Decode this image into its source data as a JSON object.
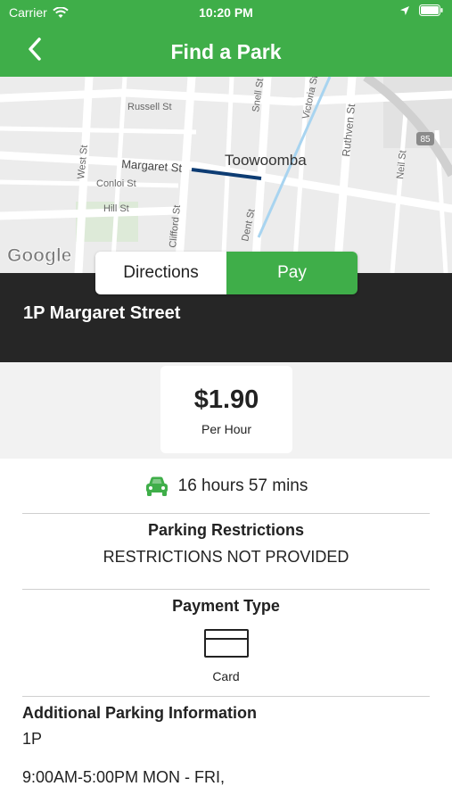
{
  "status_bar": {
    "carrier": "Carrier",
    "time": "10:20 PM"
  },
  "nav": {
    "title": "Find a Park"
  },
  "map": {
    "streets": {
      "russell": "Russell St",
      "margaret": "Margaret St",
      "conloi": "Conloi St",
      "hill": "Hill St",
      "west": "West St",
      "clifford": "Clifford St",
      "dent": "Dent St",
      "snell": "Snell St",
      "victoria": "Victoria St",
      "ruthven": "Ruthven St",
      "neil": "Neil St",
      "town": "Toowoomba",
      "highway": "85"
    },
    "google_logo": "Google",
    "highlight_color": "#0d3c73"
  },
  "segmented": {
    "directions": "Directions",
    "pay": "Pay"
  },
  "location": {
    "name": "1P Margaret Street"
  },
  "price": {
    "amount": "$1.90",
    "unit": "Per Hour"
  },
  "duration": {
    "text": "16 hours 57 mins",
    "icon": "car-icon"
  },
  "restrictions": {
    "title": "Parking Restrictions",
    "value": "RESTRICTIONS NOT PROVIDED"
  },
  "payment": {
    "title": "Payment Type",
    "card_label": "Card",
    "icon": "credit-card-icon"
  },
  "additional": {
    "title": "Additional Parking Information",
    "lines": [
      "1P",
      "9:00AM-5:00PM MON - FRI,"
    ]
  },
  "colors": {
    "brand_green": "#3fae49",
    "dark_header": "#262626"
  }
}
